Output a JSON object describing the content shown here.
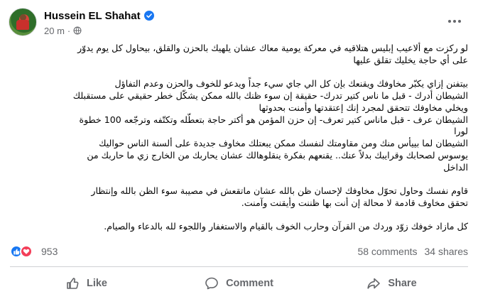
{
  "post": {
    "author": "Hussein EL Shahat",
    "timestamp": "20 m",
    "meta_sep": "·",
    "verified_icon": "verified-badge-icon",
    "privacy_icon": "globe-icon",
    "paragraphs": [
      {
        "lines": [
          "لو ركزت مع ألاعيب إبليس هتلاقيه في معركة يومية معاك عشان يلهيك بالحزن والقلق، بيحاول كل يوم يدوّر",
          "على أي حاجة يخليك تقلق عليها"
        ]
      },
      {
        "lines": [
          "بيتفنن إزاي يكبّر مخاوفك ويقنعك بإن كل الي جاي سيء جداً ويدعو للخوف والحزن وعدم التفاؤل",
          "الشيطان أدرك - قبل ما ناس كتير تدرك- حقيقة إن سوء ظنك بالله ممكن يشكّل خطر حقيقي على مستقبلك",
          "ويخلي مخاوفك تتحقق لمجرد إنك إعتقدتها وأمنت بحدوثها",
          "الشيطان عرف - قبل ماناس كتير تعرف- إن حزن المؤمن هو أكتر حاجة بتعطّله وتكتّفه وترجّعه 100 خطوة",
          "لورا",
          "الشيطان لما بييأس منك ومن مقاومتك لنفسك ممكن يبعتلك مخاوف جديدة على ألسنة الناس حواليك",
          "يوسوس لصحابك وقرايبك بدلاً عنك.. يقنعهم بفكرة ينقلوهالك عشان يحاربك من الخارج زي ما حاربك من",
          "الداخل"
        ]
      },
      {
        "lines": [
          "قاوم نفسك وحاول تحوّل مخاوفك لإحسان ظن بالله عشان ماتقعش في مصيبة سوء الظن بالله وإنتظار",
          "تحقق مخاوف قادمة لا محالة إن أنت بها ظننت وأيقنت وآمنت."
        ]
      },
      {
        "lines": [
          "كل مازاد خوفك زوّد وردك من القرآن وحارب الخوف بالقيام والاستغفار واللجوء لله بالدعاء والصيام."
        ]
      }
    ],
    "reactions": {
      "icons": [
        "like-reaction-icon",
        "love-reaction-icon"
      ],
      "count": "953",
      "comments": "58 comments",
      "shares": "34 shares"
    },
    "actions": {
      "like": "Like",
      "comment": "Comment",
      "share": "Share"
    },
    "colors": {
      "like_blue": "#1877f2",
      "love_red": "#f33e58",
      "secondary_text": "#65676b",
      "divider": "#ced0d4"
    }
  }
}
